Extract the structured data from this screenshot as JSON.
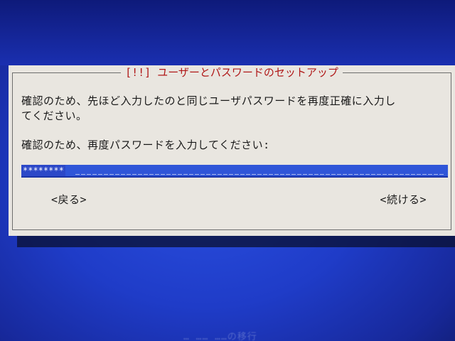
{
  "dialog": {
    "title": "[!!] ユーザーとパスワードのセットアップ",
    "message": "確認のため、先ほど入力したのと同じユーザパスワードを再度正確に入力し\nてください。",
    "prompt": "確認のため、再度パスワードを入力してください:",
    "password_field": {
      "value": "********"
    },
    "buttons": {
      "back": "<戻る>",
      "continue": "<続ける>"
    }
  },
  "footer": {
    "hint": "… …… ……の移行"
  },
  "colors": {
    "background": "#1f3cc8",
    "dialog_bg": "#e9e6e0",
    "title_color": "#b01818",
    "field_bg": "#2f55d8"
  }
}
